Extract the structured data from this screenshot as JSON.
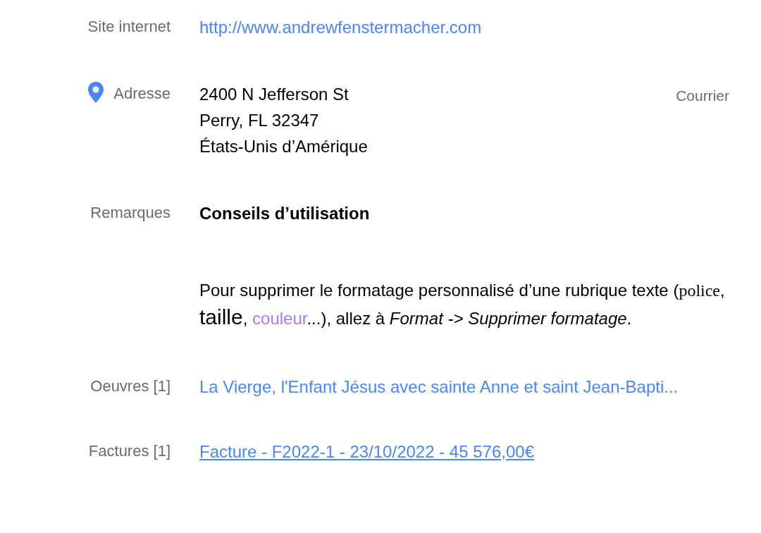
{
  "fields": [
    {
      "kind": "link",
      "label": "Site internet",
      "value": "http://www.andrewfenstermacher.com"
    },
    {
      "kind": "address",
      "label": "Adresse",
      "lines": [
        "2400 N Jefferson St",
        "Perry, FL 32347",
        "États-Unis d’Amérique"
      ],
      "tag": "Courrier"
    },
    {
      "kind": "notes",
      "label": "Remarques",
      "heading": "Conseils d’utilisation",
      "paragraph": [
        {
          "kind": "plain",
          "text": "Pour supprimer le formatage personnalisé d’une rubrique texte ("
        },
        {
          "kind": "serif",
          "text": "police"
        },
        {
          "kind": "plain",
          "text": ", "
        },
        {
          "kind": "large",
          "text": "taille"
        },
        {
          "kind": "plain",
          "text": ", "
        },
        {
          "kind": "colored",
          "text": "couleur",
          "color": "#a57cf7"
        },
        {
          "kind": "plain",
          "text": "...), allez à "
        },
        {
          "kind": "italic",
          "text": "Format -> Supprimer formatage"
        },
        {
          "kind": "plain",
          "text": "."
        }
      ]
    },
    {
      "kind": "link",
      "label": "Oeuvres [1]",
      "value": "La Vierge, l'Enfant Jésus avec sainte Anne et saint Jean-Bapti..."
    },
    {
      "kind": "underlined-link",
      "label": "Factures [1]",
      "value": "Facture - F2022-1 - 23/10/2022 - 45 576,00€"
    }
  ]
}
